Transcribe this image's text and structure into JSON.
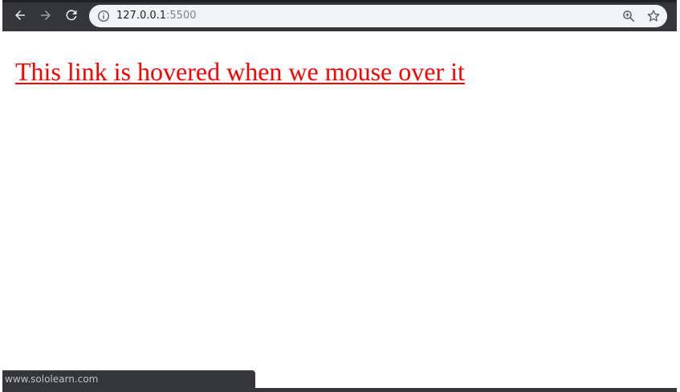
{
  "browser": {
    "url_host": "127.0.0.1",
    "url_port": ":5500",
    "icons": {
      "back": "arrow-left-icon",
      "forward": "arrow-right-icon",
      "reload": "reload-icon",
      "site_info": "info-icon",
      "zoom": "zoom-icon",
      "bookmark": "star-icon"
    },
    "colors": {
      "toolbar": "#35363a",
      "omnibox": "#f1f3f4",
      "icon": "#e8eaed",
      "icon_disabled": "#9aa0a6"
    }
  },
  "page": {
    "link_text": "This link is hovered when we mouse over it",
    "link_color": "#ff0000"
  },
  "status_bar": {
    "url": "www.sololearn.com"
  }
}
